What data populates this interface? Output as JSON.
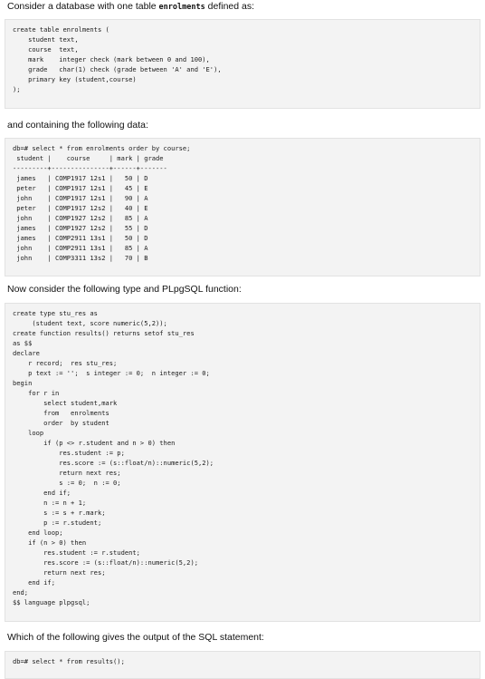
{
  "intro": {
    "text_before": "Consider a database with one table ",
    "table_name": "enrolments",
    "text_after": " defined as:"
  },
  "schema_code": "create table enrolments (\n    student text,\n    course  text,\n    mark    integer check (mark between 0 and 100),\n    grade   char(1) check (grade between 'A' and 'E'),\n    primary key (student,course)\n);",
  "data_intro": "and containing the following data:",
  "data_code": "db=# select * from enrolments order by course;\n student |    course     | mark | grade\n---------+---------------+------+-------\n james   | COMP1917 12s1 |   50 | D\n peter   | COMP1917 12s1 |   45 | E\n john    | COMP1917 12s1 |   90 | A\n peter   | COMP1917 12s2 |   40 | E\n john    | COMP1927 12s2 |   85 | A\n james   | COMP1927 12s2 |   55 | D\n james   | COMP2911 13s1 |   50 | D\n john    | COMP2911 13s1 |   85 | A\n john    | COMP3311 13s2 |   70 | B",
  "function_intro": "Now consider the following type and PLpgSQL function:",
  "function_code": "create type stu_res as\n     (student text, score numeric(5,2));\ncreate function results() returns setof stu_res\nas $$\ndeclare\n    r record;  res stu_res;\n    p text := '';  s integer := 0;  n integer := 0;\nbegin\n    for r in\n        select student,mark\n        from   enrolments\n        order  by student\n    loop\n        if (p <> r.student and n > 0) then\n            res.student := p;\n            res.score := (s::float/n)::numeric(5,2);\n            return next res;\n            s := 0;  n := 0;\n        end if;\n        n := n + 1;\n        s := s + r.mark;\n        p := r.student;\n    end loop;\n    if (n > 0) then\n        res.student := r.student;\n        res.score := (s::float/n)::numeric(5,2);\n        return next res;\n    end if;\nend;\n$$ language plpgsql;",
  "question": "Which of the following gives the output of the SQL statement:",
  "query_code": "db=# select * from results();"
}
